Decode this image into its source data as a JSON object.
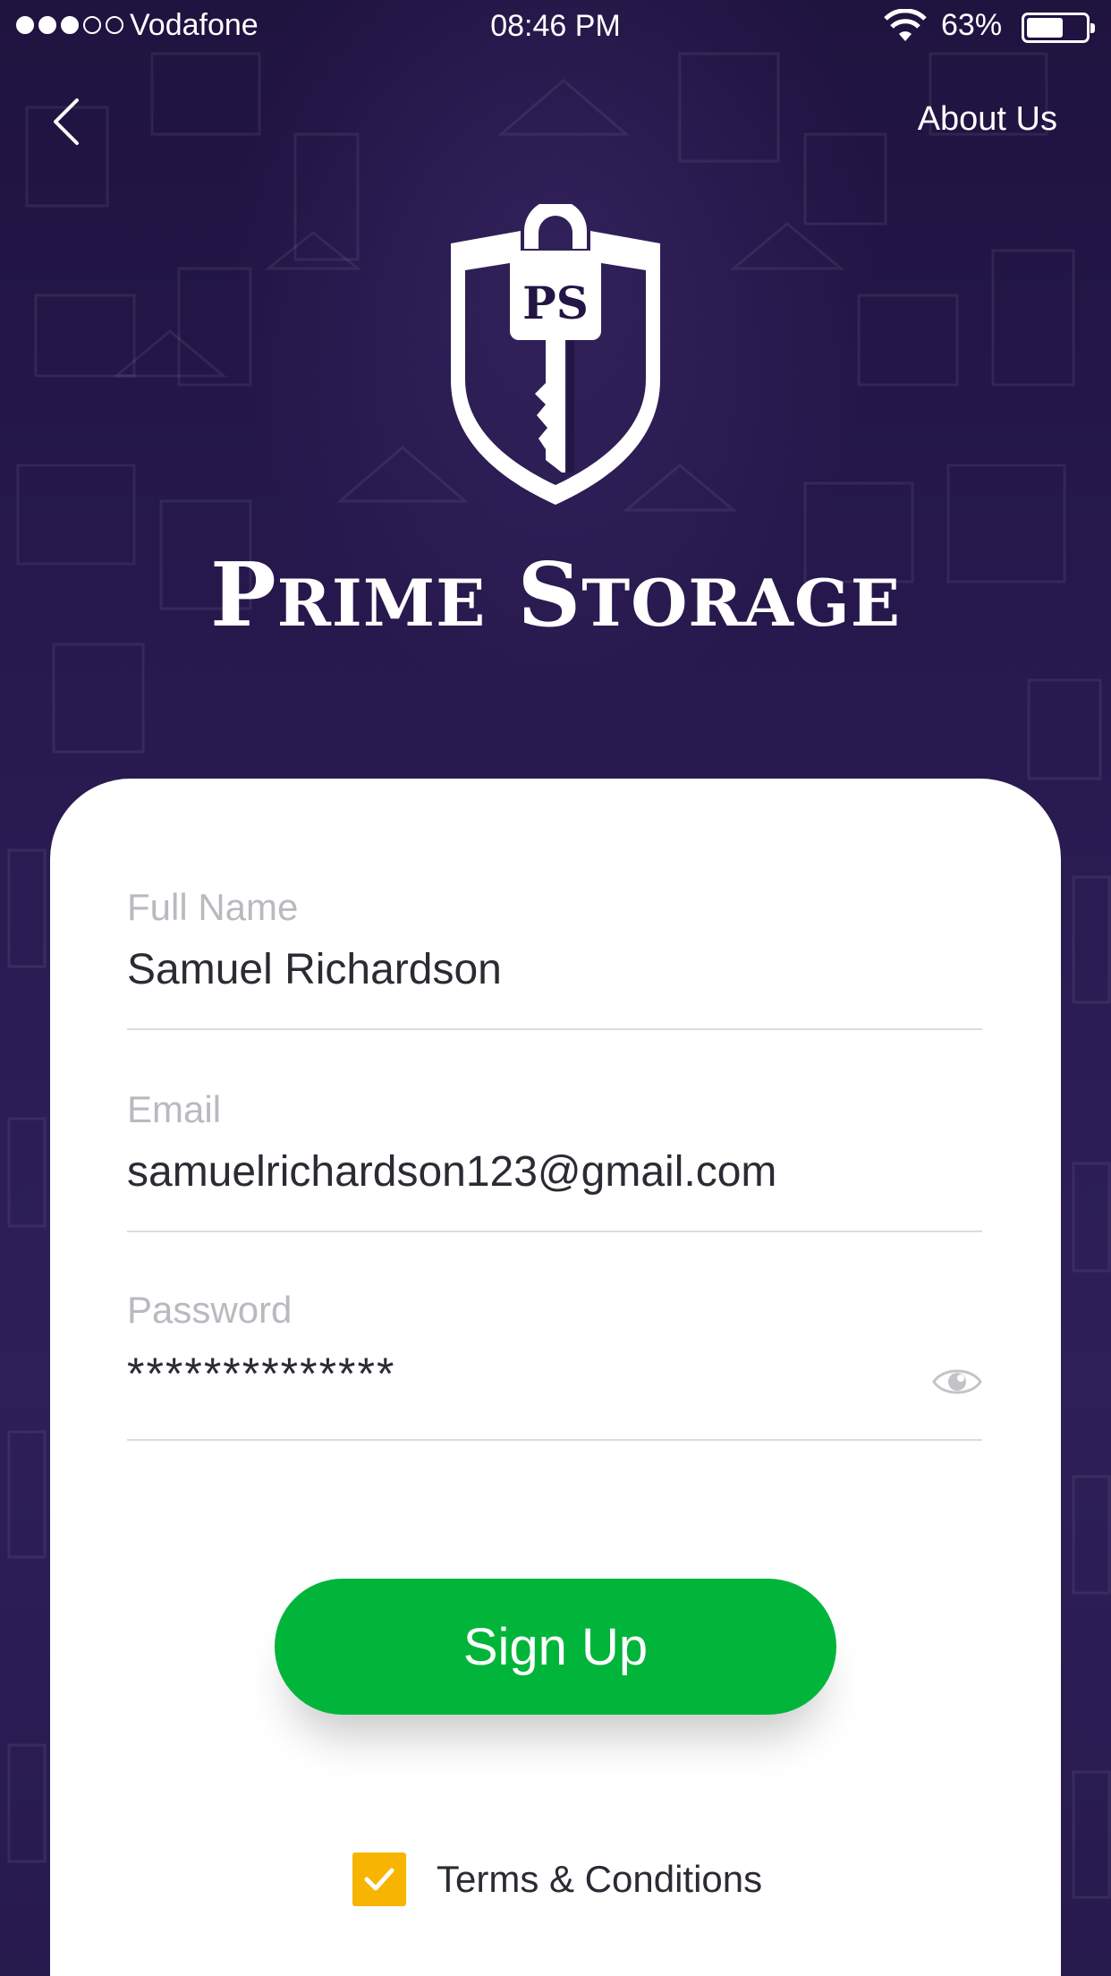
{
  "status_bar": {
    "carrier": "Vodafone",
    "time": "08:46 PM",
    "battery": "63%",
    "signal_bars_filled": 3,
    "signal_bars_total": 5
  },
  "nav": {
    "back_icon": "chevron-left-icon",
    "about_label": "About Us"
  },
  "brand": {
    "logo_initials": "PS",
    "name_part1_initial": "P",
    "name_part1_rest": "RIME",
    "name_part2_initial": "S",
    "name_part2_rest": "TORAGE"
  },
  "form": {
    "full_name": {
      "label": "Full Name",
      "value": "Samuel Richardson"
    },
    "email": {
      "label": "Email",
      "value": "samuelrichardson123@gmail.com"
    },
    "password": {
      "label": "Password",
      "value": "**************",
      "toggle_icon": "eye-icon"
    }
  },
  "actions": {
    "signup_label": "Sign Up"
  },
  "terms": {
    "label": "Terms & Conditions",
    "checked": true
  },
  "colors": {
    "background": "#231645",
    "primary_button": "#00b53a",
    "checkbox": "#f7b400",
    "label_text": "#b9b9c0",
    "value_text": "#2b2b33"
  }
}
